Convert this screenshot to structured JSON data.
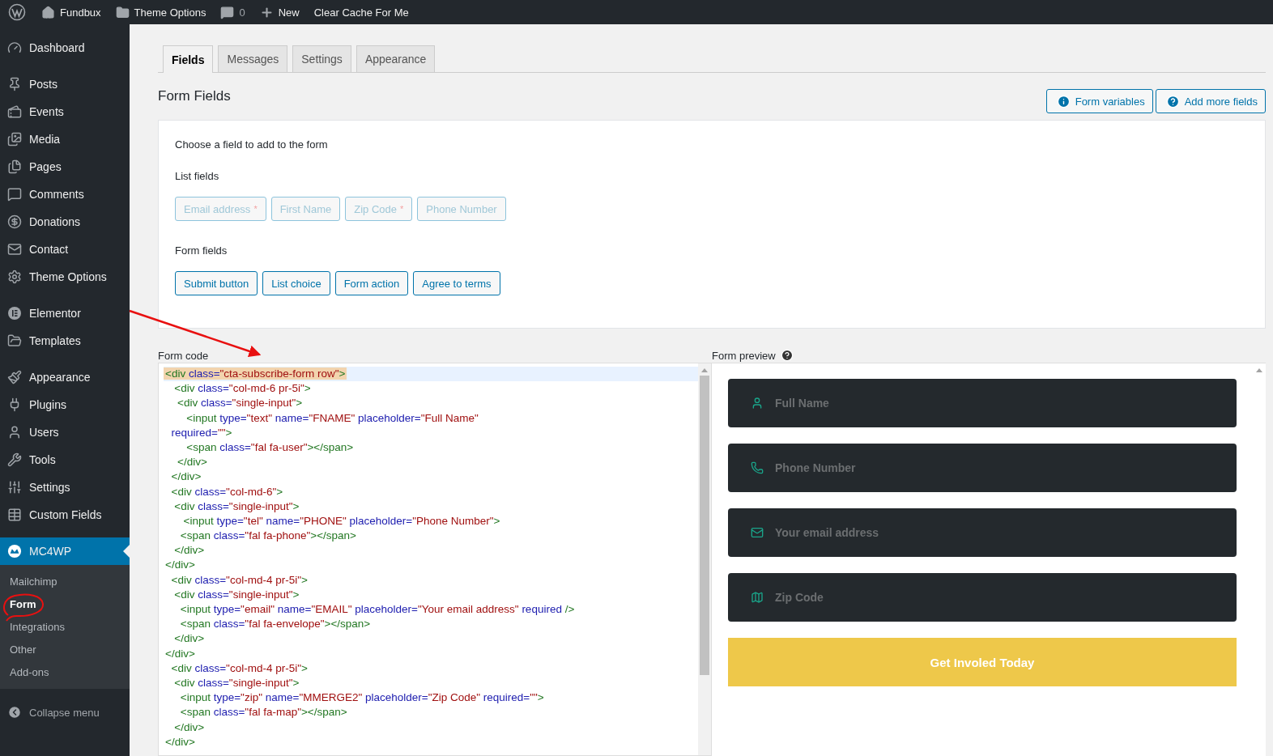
{
  "top_bar": {
    "site": "Fundbux",
    "theme_options": "Theme Options",
    "comments": "0",
    "new": "New",
    "clear_cache": "Clear Cache For Me"
  },
  "sidebar": {
    "groups": [
      [
        {
          "label": "Dashboard",
          "selected": false
        }
      ],
      [
        {
          "label": "Posts",
          "selected": false
        },
        {
          "label": "Events",
          "selected": false
        },
        {
          "label": "Media",
          "selected": false
        },
        {
          "label": "Pages",
          "selected": false
        },
        {
          "label": "Comments",
          "selected": false
        },
        {
          "label": "Donations",
          "selected": false
        },
        {
          "label": "Contact",
          "selected": false
        },
        {
          "label": "Theme Options",
          "selected": false
        }
      ],
      [
        {
          "label": "Elementor",
          "selected": false
        },
        {
          "label": "Templates",
          "selected": false
        }
      ],
      [
        {
          "label": "Appearance",
          "selected": false
        },
        {
          "label": "Plugins",
          "selected": false
        },
        {
          "label": "Users",
          "selected": false
        },
        {
          "label": "Tools",
          "selected": false
        },
        {
          "label": "Settings",
          "selected": false
        },
        {
          "label": "Custom Fields",
          "selected": false
        }
      ],
      [
        {
          "label": "MC4WP",
          "selected": true,
          "children": [
            {
              "label": "Mailchimp",
              "selected": false
            },
            {
              "label": "Form",
              "selected": true
            },
            {
              "label": "Integrations",
              "selected": false
            },
            {
              "label": "Other",
              "selected": false
            },
            {
              "label": "Add-ons",
              "selected": false
            }
          ]
        }
      ]
    ],
    "collapse": "Collapse menu"
  },
  "tabs": [
    {
      "label": "Fields",
      "selected": true
    },
    {
      "label": "Messages",
      "selected": false
    },
    {
      "label": "Settings",
      "selected": false
    },
    {
      "label": "Appearance",
      "selected": false
    }
  ],
  "heading": "Form Fields",
  "actions": [
    {
      "label": "Form variables",
      "kind": "info"
    },
    {
      "label": "Add more fields",
      "kind": "help"
    }
  ],
  "chooser": {
    "intro": "Choose a field to add to the form",
    "list_fields": {
      "title": "List fields",
      "buttons": [
        {
          "label": "Email address",
          "mark": "*",
          "disabled": true
        },
        {
          "label": "First Name",
          "disabled": true
        },
        {
          "label": "Zip Code",
          "mark": "*",
          "disabled": true
        },
        {
          "label": "Phone Number",
          "disabled": true
        }
      ]
    },
    "form_fields": {
      "title": "Form fields",
      "buttons": [
        {
          "label": "Submit button",
          "disabled": false
        },
        {
          "label": "List choice",
          "disabled": false
        },
        {
          "label": "Form action",
          "disabled": false
        },
        {
          "label": "Agree to terms",
          "disabled": false
        }
      ]
    }
  },
  "code": {
    "title": "Form code",
    "lines": [
      {
        "text": "<div class=\"cta-subscribe-form row\">",
        "selected": true
      },
      {
        "text": "   <div class=\"col-md-6 pr-5i\">",
        "selected": false
      },
      {
        "text": "    <div class=\"single-input\">",
        "selected": false
      },
      {
        "text": "       <input type=\"text\" name=\"FNAME\" placeholder=\"Full Name\"",
        "selected": false
      },
      {
        "text": "  required=\"\">",
        "selected": false
      },
      {
        "text": "       <span class=\"fal fa-user\"></span>",
        "selected": false
      },
      {
        "text": "    </div>",
        "selected": false
      },
      {
        "text": "  </div>",
        "selected": false
      },
      {
        "text": "  <div class=\"col-md-6\">",
        "selected": false
      },
      {
        "text": "   <div class=\"single-input\">",
        "selected": false
      },
      {
        "text": "      <input type=\"tel\" name=\"PHONE\" placeholder=\"Phone Number\">",
        "selected": false
      },
      {
        "text": "     <span class=\"fal fa-phone\"></span>",
        "selected": false
      },
      {
        "text": "   </div>",
        "selected": false
      },
      {
        "text": "</div>",
        "selected": false
      },
      {
        "text": "  <div class=\"col-md-4 pr-5i\">",
        "selected": false
      },
      {
        "text": "   <div class=\"single-input\">",
        "selected": false
      },
      {
        "text": "     <input type=\"email\" name=\"EMAIL\" placeholder=\"Your email address\" required />",
        "selected": false
      },
      {
        "text": "     <span class=\"fal fa-envelope\"></span>",
        "selected": false
      },
      {
        "text": "   </div>",
        "selected": false
      },
      {
        "text": "</div>",
        "selected": false
      },
      {
        "text": "  <div class=\"col-md-4 pr-5i\">",
        "selected": false
      },
      {
        "text": "   <div class=\"single-input\">",
        "selected": false
      },
      {
        "text": "     <input type=\"zip\" name=\"MMERGE2\" placeholder=\"Zip Code\" required=\"\">",
        "selected": false
      },
      {
        "text": "     <span class=\"fal fa-map\"></span>",
        "selected": false
      },
      {
        "text": "   </div>",
        "selected": false
      },
      {
        "text": "</div>",
        "selected": false
      }
    ]
  },
  "preview": {
    "title": "Form preview",
    "fields": [
      {
        "placeholder": "Full Name",
        "kind": "user"
      },
      {
        "placeholder": "Phone Number",
        "kind": "phone"
      },
      {
        "placeholder": "Your email address",
        "kind": "email"
      },
      {
        "placeholder": "Zip Code",
        "kind": "map"
      }
    ],
    "submit": "Get Involed Today"
  }
}
